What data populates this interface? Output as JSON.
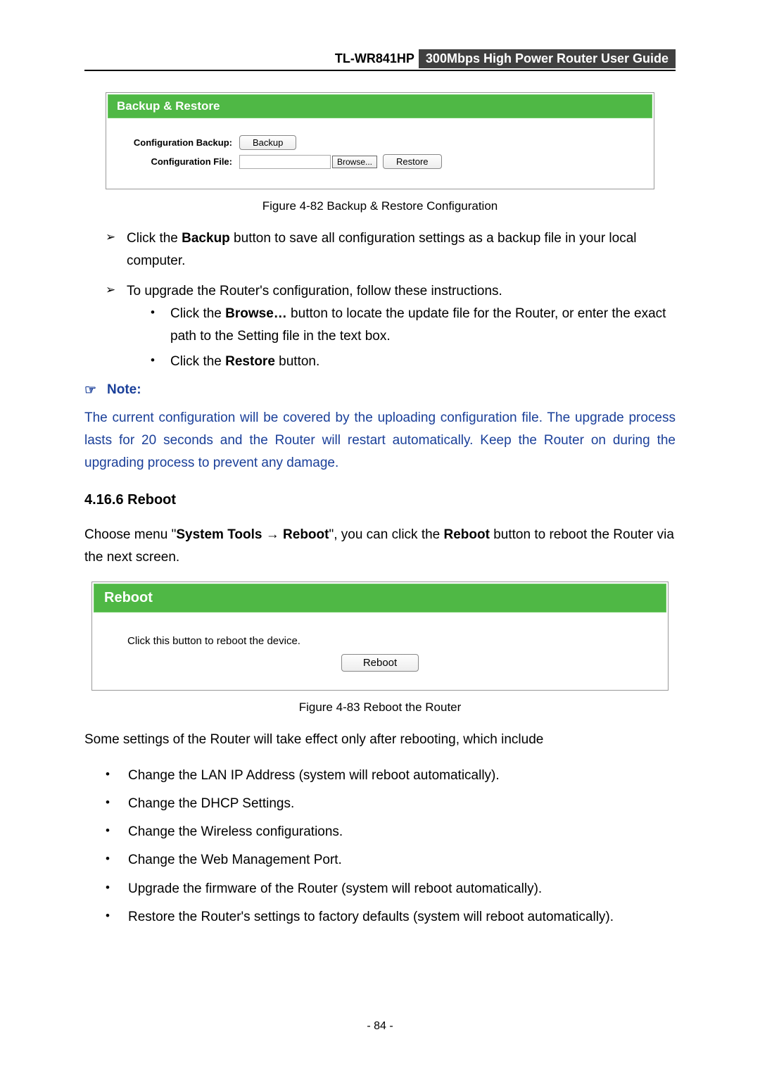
{
  "header": {
    "model": "TL-WR841HP",
    "subtitle": "300Mbps High Power Router User Guide"
  },
  "backup_panel": {
    "title": "Backup & Restore",
    "row1_label": "Configuration Backup:",
    "row2_label": "Configuration File:",
    "backup_btn": "Backup",
    "browse_btn": "Browse...",
    "restore_btn": "Restore"
  },
  "caption1": "Figure 4-82   Backup & Restore Configuration",
  "arrow1_pre": "Click the ",
  "arrow1_bold": "Backup",
  "arrow1_post": " button to save all configuration settings as a backup file in your local computer.",
  "arrow2": "To upgrade the Router's configuration, follow these instructions.",
  "sub1_pre": "Click the ",
  "sub1_bold": "Browse…",
  "sub1_post": " button to locate the update file for the Router, or enter the exact path to the Setting file in the text box.",
  "sub2_pre": "Click the ",
  "sub2_bold": "Restore",
  "sub2_post": " button.",
  "note_label": "Note:",
  "note_para": "The current configuration will be covered by the uploading configuration file. The upgrade process lasts for 20 seconds and the Router will restart automatically. Keep the Router on during the upgrading process to prevent any damage.",
  "section_num": "4.16.6 Reboot",
  "choose_pre": "Choose menu \"",
  "choose_bold1": "System Tools",
  "choose_arrow": "  →  ",
  "choose_bold2": "Reboot",
  "choose_mid": "\", you can click the ",
  "choose_bold3": "Reboot",
  "choose_post": " button to reboot the Router via the next screen.",
  "reboot_panel": {
    "title": "Reboot",
    "instruction": "Click this button to reboot the device.",
    "reboot_btn": "Reboot"
  },
  "caption2": "Figure 4-83 Reboot the Router",
  "settings_intro": "Some settings of the Router will take effect only after rebooting, which include",
  "settings_list": {
    "i0": "Change the LAN IP Address (system will reboot automatically).",
    "i1": "Change the DHCP Settings.",
    "i2": "Change the Wireless configurations.",
    "i3": "Change the Web Management Port.",
    "i4": "Upgrade the firmware of the Router (system will reboot automatically).",
    "i5": "Restore the Router's settings to factory defaults (system will reboot automatically)."
  },
  "page_number": "- 84 -"
}
